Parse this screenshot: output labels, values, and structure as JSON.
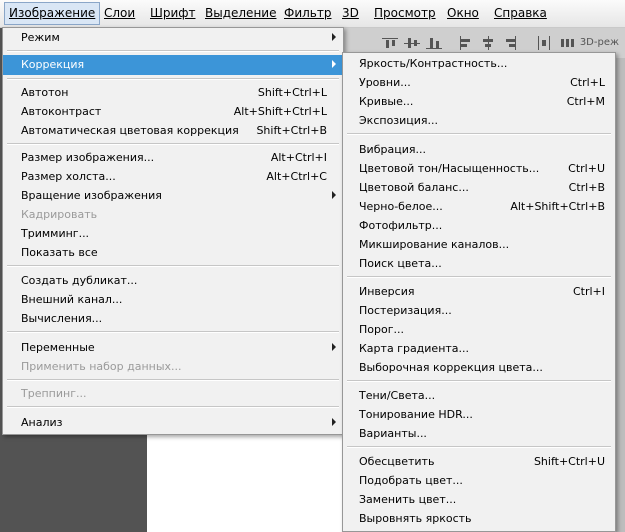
{
  "menubar": {
    "items": [
      {
        "label": "Изображение",
        "active": true
      },
      {
        "label": "Слои"
      },
      {
        "label": "Шрифт"
      },
      {
        "label": "Выделение"
      },
      {
        "label": "Фильтр"
      },
      {
        "label": "3D"
      },
      {
        "label": "Просмотр"
      },
      {
        "label": "Окно"
      },
      {
        "label": "Справка"
      }
    ]
  },
  "toolbar": {
    "mode_3d": "3D-реж"
  },
  "image_menu": {
    "items": [
      {
        "label": "Режим",
        "submenu": true
      },
      {
        "label": "Коррекция",
        "submenu": true,
        "highlighted": true
      },
      {
        "label": "Автотон",
        "shortcut": "Shift+Ctrl+L"
      },
      {
        "label": "Автоконтраст",
        "shortcut": "Alt+Shift+Ctrl+L"
      },
      {
        "label": "Автоматическая цветовая коррекция",
        "shortcut": "Shift+Ctrl+B"
      },
      {
        "label": "Размер изображения...",
        "shortcut": "Alt+Ctrl+I"
      },
      {
        "label": "Размер холста...",
        "shortcut": "Alt+Ctrl+C"
      },
      {
        "label": "Вращение изображения",
        "submenu": true
      },
      {
        "label": "Кадрировать",
        "disabled": true
      },
      {
        "label": "Тримминг..."
      },
      {
        "label": "Показать все"
      },
      {
        "label": "Создать дубликат..."
      },
      {
        "label": "Внешний канал..."
      },
      {
        "label": "Вычисления..."
      },
      {
        "label": "Переменные",
        "submenu": true
      },
      {
        "label": "Применить набор данных...",
        "disabled": true
      },
      {
        "label": "Треппинг...",
        "disabled": true
      },
      {
        "label": "Анализ",
        "submenu": true
      }
    ]
  },
  "adjust_menu": {
    "items": [
      {
        "label": "Яркость/Контрастность..."
      },
      {
        "label": "Уровни...",
        "shortcut": "Ctrl+L"
      },
      {
        "label": "Кривые...",
        "shortcut": "Ctrl+M"
      },
      {
        "label": "Экспозиция..."
      },
      {
        "label": "Вибрация..."
      },
      {
        "label": "Цветовой тон/Насыщенность...",
        "shortcut": "Ctrl+U"
      },
      {
        "label": "Цветовой баланс...",
        "shortcut": "Ctrl+B"
      },
      {
        "label": "Черно-белое...",
        "shortcut": "Alt+Shift+Ctrl+B"
      },
      {
        "label": "Фотофильтр..."
      },
      {
        "label": "Микширование каналов..."
      },
      {
        "label": "Поиск цвета..."
      },
      {
        "label": "Инверсия",
        "shortcut": "Ctrl+I"
      },
      {
        "label": "Постеризация..."
      },
      {
        "label": "Порог..."
      },
      {
        "label": "Карта градиента..."
      },
      {
        "label": "Выборочная коррекция цвета..."
      },
      {
        "label": "Тени/Света..."
      },
      {
        "label": "Тонирование HDR..."
      },
      {
        "label": "Варианты..."
      },
      {
        "label": "Обесцветить",
        "shortcut": "Shift+Ctrl+U"
      },
      {
        "label": "Подобрать цвет..."
      },
      {
        "label": "Заменить цвет..."
      },
      {
        "label": "Выровнять яркость"
      }
    ]
  }
}
